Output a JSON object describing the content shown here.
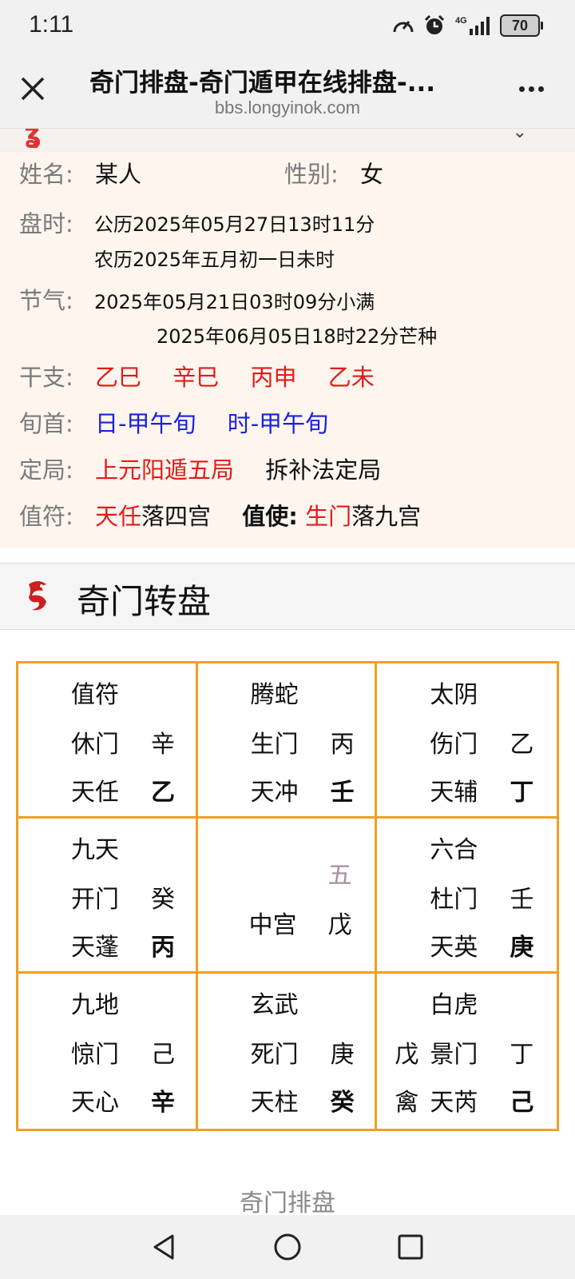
{
  "status": {
    "time": "1:11",
    "battery": "70",
    "network": "4G"
  },
  "browser": {
    "title": "奇门排盘-奇门遁甲在线排盘-...",
    "url": "bbs.longyinok.com"
  },
  "info": {
    "name_label": "姓名:",
    "name_value": "某人",
    "gender_label": "性别:",
    "gender_value": "女",
    "time_label": "盘时:",
    "time_solar": "公历2025年05月27日13时11分",
    "time_lunar": "农历2025年五月初一日未时",
    "jieqi_label": "节气:",
    "jieqi_1": "2025年05月21日03时09分小满",
    "jieqi_2": "2025年06月05日18时22分芒种",
    "ganzhi_label": "干支:",
    "ganzhi": [
      "乙巳",
      "辛巳",
      "丙申",
      "乙未"
    ],
    "xunshou_label": "旬首:",
    "xunshou": [
      "日-甲午旬",
      "时-甲午旬"
    ],
    "dingju_label": "定局:",
    "dingju_value": "上元阳遁五局",
    "dingju_method": "拆补法定局",
    "zhifu_label": "值符:",
    "zhifu_star": "天任",
    "zhifu_palace": "落四宫",
    "zhishi_label": "值使:",
    "zhishi_door": "生门",
    "zhishi_palace": "落九宫"
  },
  "section": {
    "title": "奇门转盘"
  },
  "grid": [
    {
      "god": "值符",
      "door": "休门",
      "door_stem": "辛",
      "star": "天任",
      "star_stem": "乙"
    },
    {
      "god": "腾蛇",
      "door": "生门",
      "door_stem": "丙",
      "star": "天冲",
      "star_stem": "壬"
    },
    {
      "god": "太阴",
      "door": "伤门",
      "door_stem": "乙",
      "star": "天辅",
      "star_stem": "丁"
    },
    {
      "god": "九天",
      "door": "开门",
      "door_stem": "癸",
      "star": "天蓬",
      "star_stem": "丙"
    },
    {
      "center_num": "五",
      "center_label": "中宫",
      "center_stem": "戊"
    },
    {
      "god": "六合",
      "door": "杜门",
      "door_stem": "壬",
      "star": "天英",
      "star_stem": "庚"
    },
    {
      "god": "九地",
      "door": "惊门",
      "door_stem": "己",
      "star": "天心",
      "star_stem": "辛"
    },
    {
      "god": "玄武",
      "door": "死门",
      "door_stem": "庚",
      "star": "天柱",
      "star_stem": "癸"
    },
    {
      "god": "白虎",
      "door_prefix": "戊",
      "door": "景门",
      "door_stem": "丁",
      "star_prefix": "禽",
      "star": "天芮",
      "star_stem": "己"
    }
  ],
  "footer": {
    "text": "奇门排盘"
  }
}
